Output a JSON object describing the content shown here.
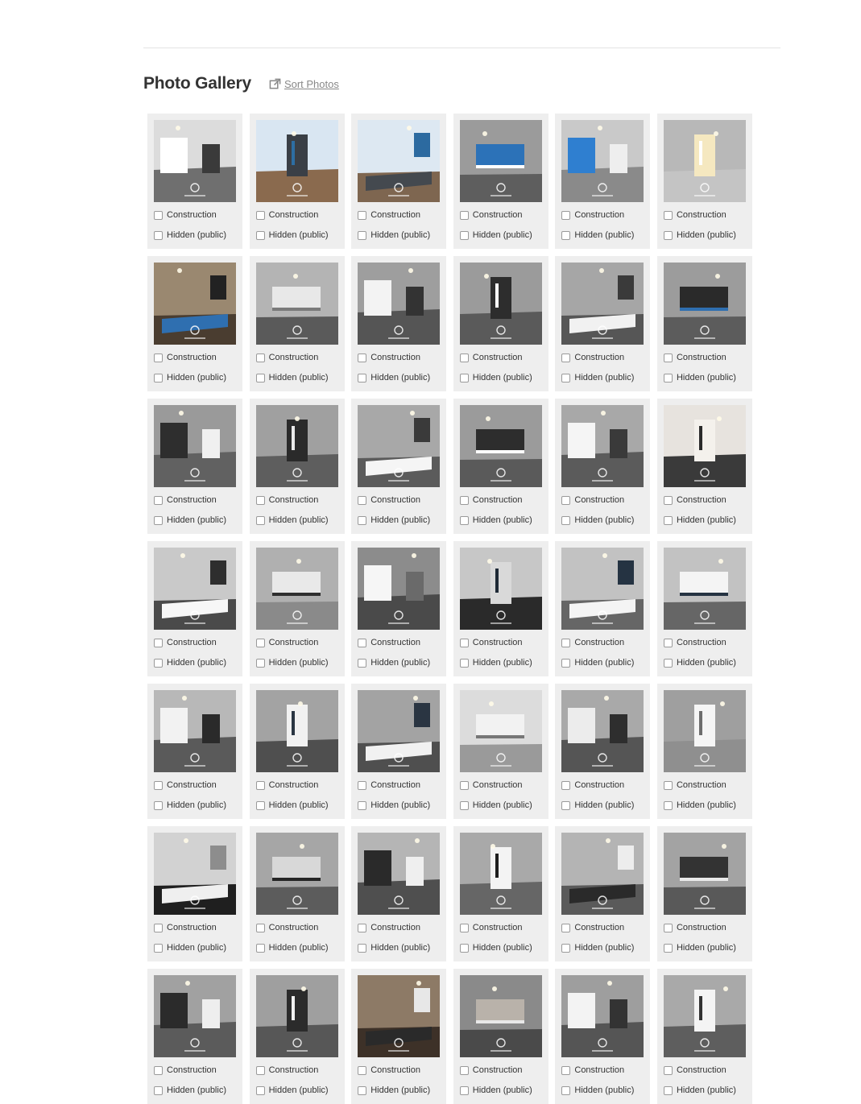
{
  "gallery": {
    "title": "Photo Gallery",
    "sort_label": "Sort Photos",
    "option_labels": {
      "construction": "Construction",
      "hidden": "Hidden (public)"
    },
    "photos": [
      {
        "scene": "kitchen-hall"
      },
      {
        "scene": "exterior-front"
      },
      {
        "scene": "exterior-sign"
      },
      {
        "scene": "front-door"
      },
      {
        "scene": "foyer-skylight"
      },
      {
        "scene": "ceiling-light"
      },
      {
        "scene": "blue-door-hall"
      },
      {
        "scene": "hallway"
      },
      {
        "scene": "kitchen-island"
      },
      {
        "scene": "living-fireplace"
      },
      {
        "scene": "kitchen-window"
      },
      {
        "scene": "stair-railing"
      },
      {
        "scene": "living-room"
      },
      {
        "scene": "living-railing"
      },
      {
        "scene": "kitchen-wide"
      },
      {
        "scene": "living-fireplace"
      },
      {
        "scene": "kitchen-wide"
      },
      {
        "scene": "quartz-counter"
      },
      {
        "scene": "island-closeup"
      },
      {
        "scene": "kitchen-long"
      },
      {
        "scene": "counter-closeup"
      },
      {
        "scene": "range-hood"
      },
      {
        "scene": "kitchen-hood"
      },
      {
        "scene": "kitchen-hood"
      },
      {
        "scene": "kitchen-full"
      },
      {
        "scene": "kitchen-range"
      },
      {
        "scene": "kitchen-range"
      },
      {
        "scene": "hood-angle"
      },
      {
        "scene": "kitchen-sink"
      },
      {
        "scene": "pendant-light"
      },
      {
        "scene": "backsplash"
      },
      {
        "scene": "stair-opening"
      },
      {
        "scene": "dining-light"
      },
      {
        "scene": "wall-ovens"
      },
      {
        "scene": "dining-railing"
      },
      {
        "scene": "fireplace-wall"
      },
      {
        "scene": "railing-room"
      },
      {
        "scene": "dining-room"
      },
      {
        "scene": "stairwell"
      },
      {
        "scene": "counter-edge"
      },
      {
        "scene": "kitchen-island"
      },
      {
        "scene": "kitchen-bar"
      }
    ]
  }
}
